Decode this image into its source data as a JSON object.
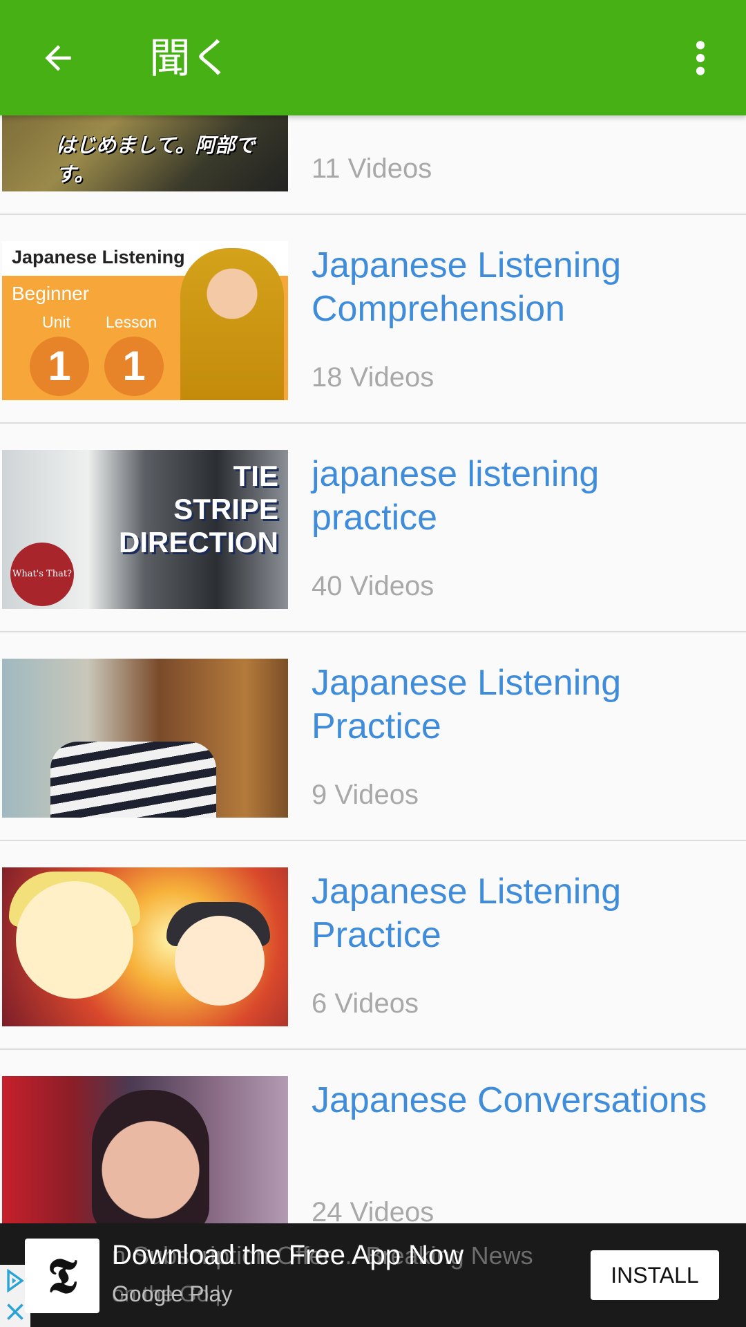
{
  "app_bar": {
    "title": "聞く",
    "back_icon": "arrow-back-icon",
    "menu_icon": "more-vert-icon",
    "color": "#47b014"
  },
  "playlists": [
    {
      "title": "",
      "count": "11 Videos",
      "thumb_caption": "はじめまして。阿部です。"
    },
    {
      "title": "Japanese Listening Comprehension",
      "count": "18 Videos",
      "thumb": {
        "header": "Japanese Listening",
        "level": "Beginner",
        "unit_label": "Unit",
        "lesson_label": "Lesson",
        "unit": "1",
        "lesson": "1"
      }
    },
    {
      "title": "japanese listening practice",
      "count": "40 Videos",
      "thumb": {
        "line1": "TIE",
        "line2": "STRIPE",
        "line3": "DIRECTION",
        "seal": "What's That?"
      }
    },
    {
      "title": "Japanese Listening Practice",
      "count": "9 Videos"
    },
    {
      "title": "Japanese Listening Practice",
      "count": "6 Videos"
    },
    {
      "title": "Japanese Conversations",
      "count": "24 Videos"
    }
  ],
  "ad": {
    "headline": "Download the Free App Now",
    "ghost_text": "n Subscription Offer ... Breaking News",
    "sub": "Google Play",
    "ghost_sub": "on the Go   |",
    "button": "INSTALL",
    "logo": "𝕿",
    "adchoices_icon": "adchoices-icon",
    "close_icon": "close-icon"
  },
  "colors": {
    "title_blue": "#3f8cdb",
    "count_gray": "#a8a8a8"
  }
}
